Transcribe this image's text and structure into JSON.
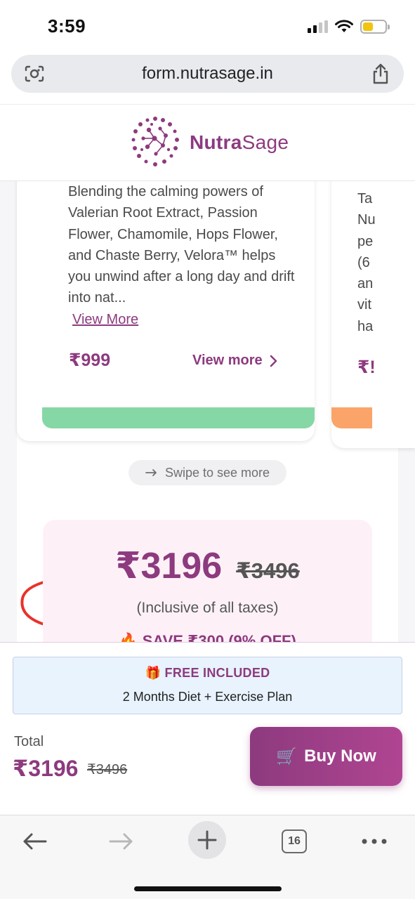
{
  "status_bar": {
    "time": "3:59",
    "battery_level": 0.45,
    "battery_color": "#f1c40f"
  },
  "browser": {
    "url": "form.nutrasage.in",
    "left_icon": "lens-icon",
    "right_icon": "share-icon",
    "tab_count": "16"
  },
  "header": {
    "brand_part1": "Nutra",
    "brand_part2": "Sage",
    "brand_color": "#8d3a7f"
  },
  "product_card": {
    "description": "Blending the calming powers of Valerian Root Extract, Passion Flower, Chamomile, Hops Flower, and Chaste Berry, Velora™ helps you unwind after a long day and drift into nat...",
    "view_more_link": "View More",
    "price": "₹999",
    "view_more_button": "View more",
    "bar_color": "#86d7a6"
  },
  "next_card_peek": {
    "lines": [
      "Ta",
      "Nu",
      "pe",
      "(6",
      "an",
      "vit",
      "ha"
    ],
    "price": "₹!",
    "bar_color": "#fba46a"
  },
  "swipe_hint": {
    "text": "Swipe to see more"
  },
  "price_box": {
    "current": "₹3196",
    "original": "₹3496",
    "tax_note": "(Inclusive of all taxes)",
    "save": "🔥 SAVE ₹300 (9% OFF)"
  },
  "sticky_bar": {
    "free_title": "FREE INCLUDED",
    "free_subtitle": "2 Months Diet + Exercise Plan",
    "total_label": "Total",
    "total_now": "₹3196",
    "total_was": "₹3496",
    "buy_button": "Buy Now"
  },
  "annotation": {
    "color": "#e8322b"
  }
}
